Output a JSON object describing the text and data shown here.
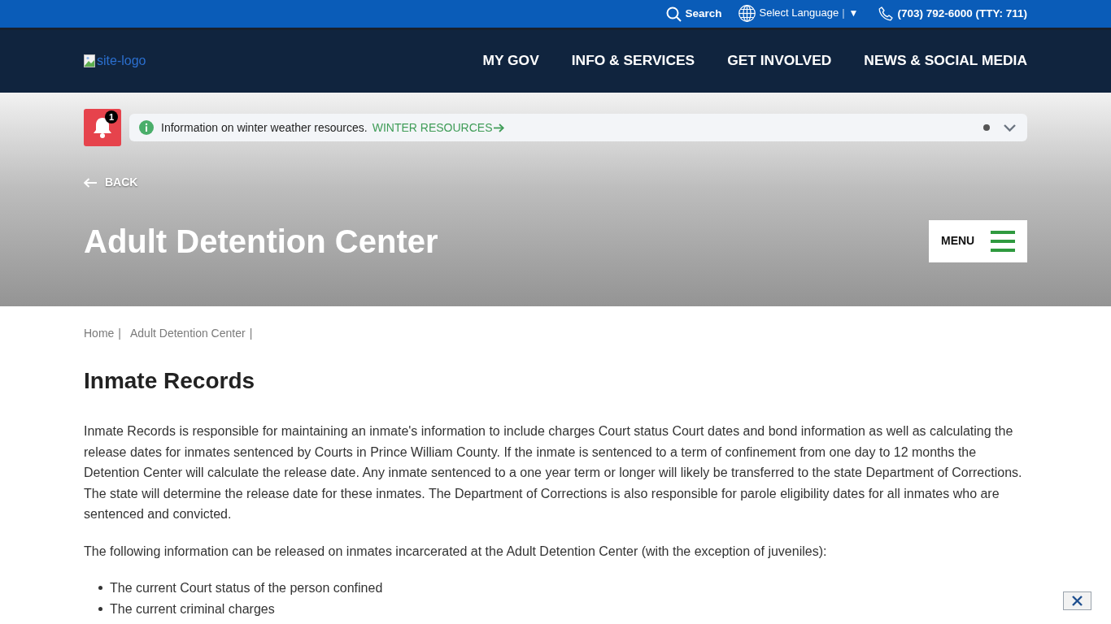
{
  "utility_bar": {
    "search": {
      "label": "Search"
    },
    "language": {
      "label": "Select Language",
      "separator": "|",
      "caret": "▼"
    },
    "phone": {
      "label": "(703) 792-6000 (TTY: 711)"
    }
  },
  "header": {
    "logo": {
      "alt_text": "site-logo"
    },
    "nav": [
      {
        "label": "MY GOV"
      },
      {
        "label": "INFO & SERVICES"
      },
      {
        "label": "GET INVOLVED"
      },
      {
        "label": "NEWS & SOCIAL MEDIA"
      }
    ]
  },
  "alert": {
    "count": "1",
    "message": "Information on winter weather resources.",
    "link": "WINTER RESOURCES",
    "pager": [
      {
        "selected": true
      }
    ]
  },
  "hero": {
    "back": "BACK",
    "title": "Adult Detention Center",
    "menu_button": "MENU"
  },
  "breadcrumb": [
    {
      "label": "Home",
      "separator": "|"
    },
    {
      "label": "Adult Detention Center",
      "separator": "|"
    }
  ],
  "content": {
    "heading": "Inmate Records",
    "paragraphs": [
      "Inmate Records is responsible for maintaining an inmate's information to include charges Court status Court dates and bond information as well as calculating the release dates for inmates sentenced by Courts in Prince William County. If the inmate is sentenced to a term of confinement from one day to 12 months the Detention Center will calculate the release date. Any inmate sentenced to a one year term or longer will likely be transferred to the state Department of Corrections. The state will determine the release date for these inmates. The Department of Corrections is also responsible for parole eligibility dates for all inmates who are sentenced and convicted.",
      "The following information can be released on inmates incarcerated at the Adult Detention Center (with the exception of juveniles):"
    ],
    "list": [
      "The current Court status of the person confined",
      "The current criminal charges"
    ]
  }
}
